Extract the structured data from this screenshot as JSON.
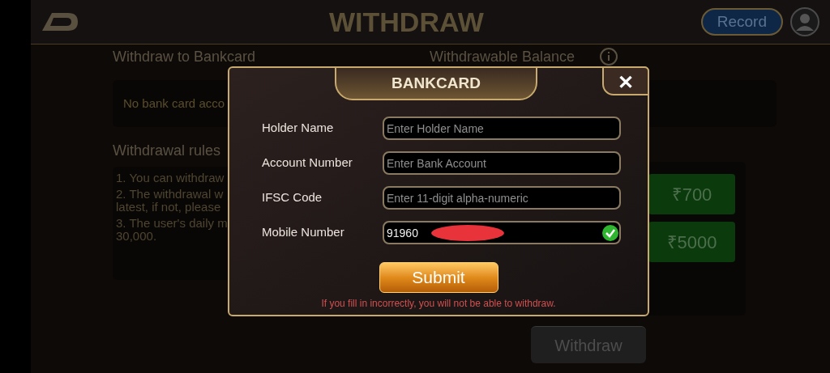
{
  "header": {
    "title": "WITHDRAW",
    "record_button": "Record"
  },
  "bankcard_section": {
    "title": "Withdraw to Bankcard",
    "message": "No bank card acco"
  },
  "balance_section": {
    "title": "Withdrawable Balance"
  },
  "rules_section": {
    "title": "Withdrawal rules",
    "rules": [
      {
        "lines": [
          "1. You can withdraw"
        ]
      },
      {
        "lines": [
          "2. The withdrawal w",
          "latest, if not, please"
        ]
      },
      {
        "lines": [
          "3. The user's daily m",
          "30,000."
        ]
      }
    ]
  },
  "amounts": [
    {
      "label": "₹700"
    },
    {
      "label": "₹5000"
    }
  ],
  "withdraw_button": {
    "label": "Withdraw",
    "disabled": true
  },
  "dialog": {
    "title": "BANKCARD",
    "close": "✕",
    "fields": [
      {
        "label": "Holder Name",
        "placeholder": "Enter Holder Name"
      },
      {
        "label": "Account Number",
        "placeholder": "Enter Bank Account"
      },
      {
        "label": "IFSC Code",
        "placeholder": "Enter 11-digit alpha-numeric"
      },
      {
        "label": "Mobile Number",
        "value": "91960",
        "valid": true
      }
    ],
    "submit": "Submit",
    "warning": "If you fill in incorrectly, you will not be able to withdraw."
  }
}
